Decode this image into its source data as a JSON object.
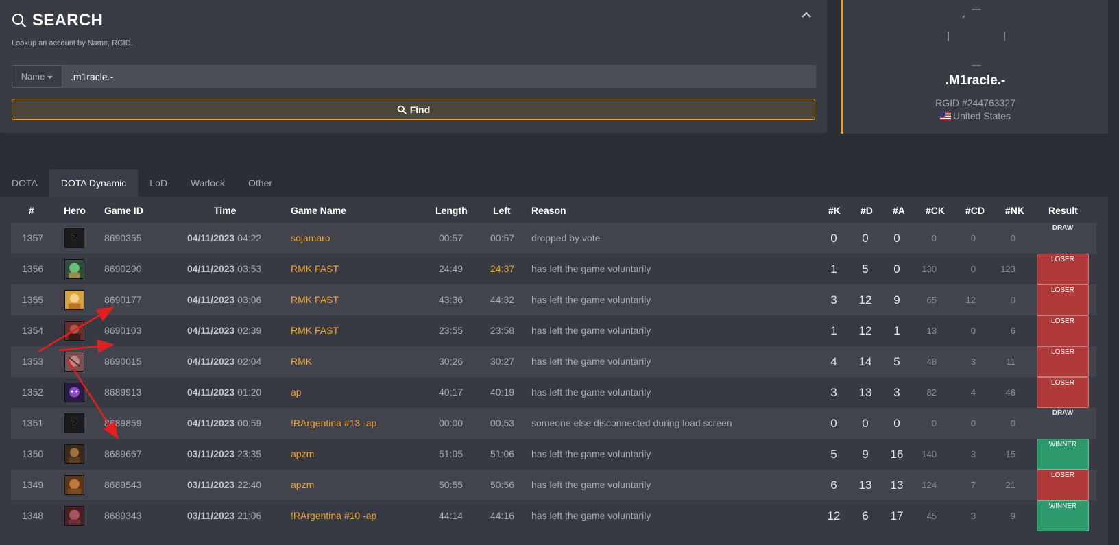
{
  "search": {
    "title": "SEARCH",
    "subtitle": "Lookup an account by Name, RGID.",
    "type_label": "Name",
    "query_value": ".m1racle.-",
    "find_label": "Find"
  },
  "profile": {
    "name": ".M1racle.-",
    "rgid": "RGID #244763327",
    "country": "United States"
  },
  "tabs": [
    "DOTA",
    "DOTA Dynamic",
    "LoD",
    "Warlock",
    "Other"
  ],
  "active_tab": "DOTA Dynamic",
  "table": {
    "headers": [
      "#",
      "Hero",
      "Game ID",
      "Time",
      "Game Name",
      "Length",
      "Left",
      "Reason",
      "#K",
      "#D",
      "#A",
      "#CK",
      "#CD",
      "#NK",
      "Result"
    ],
    "rows": [
      {
        "num": "1357",
        "hero": "unknown-hero",
        "game_id": "8690355",
        "date": "04/11/2023",
        "time": "04:22",
        "game_name": "sojamaro",
        "length": "00:57",
        "left": "00:57",
        "reason": "dropped by vote",
        "k": "0",
        "d": "0",
        "a": "0",
        "ck": "0",
        "cd": "0",
        "nk": "0",
        "result": "DRAW"
      },
      {
        "num": "1356",
        "hero": "green-hero",
        "game_id": "8690290",
        "date": "04/11/2023",
        "time": "03:53",
        "game_name": "RMK FAST",
        "length": "24:49",
        "left": "24:37",
        "reason": "has left the game voluntarily",
        "k": "1",
        "d": "5",
        "a": "0",
        "ck": "130",
        "cd": "0",
        "nk": "123",
        "result": "LOSER"
      },
      {
        "num": "1355",
        "hero": "gold-hero",
        "game_id": "8690177",
        "date": "04/11/2023",
        "time": "03:06",
        "game_name": "RMK FAST",
        "length": "43:36",
        "left": "44:32",
        "reason": "has left the game voluntarily",
        "k": "3",
        "d": "12",
        "a": "9",
        "ck": "65",
        "cd": "12",
        "nk": "0",
        "result": "LOSER"
      },
      {
        "num": "1354",
        "hero": "red-hero",
        "game_id": "8690103",
        "date": "04/11/2023",
        "time": "02:39",
        "game_name": "RMK FAST",
        "length": "23:55",
        "left": "23:58",
        "reason": "has left the game voluntarily",
        "k": "1",
        "d": "12",
        "a": "1",
        "ck": "13",
        "cd": "0",
        "nk": "6",
        "result": "LOSER"
      },
      {
        "num": "1353",
        "hero": "flesh-hero",
        "game_id": "8690015",
        "date": "04/11/2023",
        "time": "02:04",
        "game_name": "RMK",
        "length": "30:26",
        "left": "30:27",
        "reason": "has left the game voluntarily",
        "k": "4",
        "d": "14",
        "a": "5",
        "ck": "48",
        "cd": "3",
        "nk": "11",
        "result": "LOSER"
      },
      {
        "num": "1352",
        "hero": "purple-hero",
        "game_id": "8689913",
        "date": "04/11/2023",
        "time": "01:20",
        "game_name": "ap",
        "length": "40:17",
        "left": "40:19",
        "reason": "has left the game voluntarily",
        "k": "3",
        "d": "13",
        "a": "3",
        "ck": "82",
        "cd": "4",
        "nk": "46",
        "result": "LOSER"
      },
      {
        "num": "1351",
        "hero": "unknown-hero",
        "game_id": "8689859",
        "date": "04/11/2023",
        "time": "00:59",
        "game_name": "!RArgentina #13 -ap",
        "length": "00:00",
        "left": "00:53",
        "reason": "someone else disconnected during load screen",
        "k": "0",
        "d": "0",
        "a": "0",
        "ck": "0",
        "cd": "0",
        "nk": "0",
        "result": "DRAW"
      },
      {
        "num": "1350",
        "hero": "brown-hero",
        "game_id": "8689667",
        "date": "03/11/2023",
        "time": "23:35",
        "game_name": "apzm",
        "length": "51:05",
        "left": "51:06",
        "reason": "has left the game voluntarily",
        "k": "5",
        "d": "9",
        "a": "16",
        "ck": "140",
        "cd": "3",
        "nk": "15",
        "result": "WINNER"
      },
      {
        "num": "1349",
        "hero": "orange-hero",
        "game_id": "8689543",
        "date": "03/11/2023",
        "time": "22:40",
        "game_name": "apzm",
        "length": "50:55",
        "left": "50:56",
        "reason": "has left the game voluntarily",
        "k": "6",
        "d": "13",
        "a": "13",
        "ck": "124",
        "cd": "7",
        "nk": "21",
        "result": "LOSER"
      },
      {
        "num": "1348",
        "hero": "maroon-hero",
        "game_id": "8689343",
        "date": "03/11/2023",
        "time": "21:06",
        "game_name": "!RArgentina #10 -ap",
        "length": "44:14",
        "left": "44:16",
        "reason": "has left the game voluntarily",
        "k": "12",
        "d": "6",
        "a": "17",
        "ck": "45",
        "cd": "3",
        "nk": "9",
        "result": "WINNER"
      }
    ]
  },
  "colors": {
    "accent": "#e8a42c",
    "game_name": "#f0a630",
    "loser": "#b03a3a",
    "winner": "#2d9a6d",
    "annotation_arrow": "#e02020"
  }
}
